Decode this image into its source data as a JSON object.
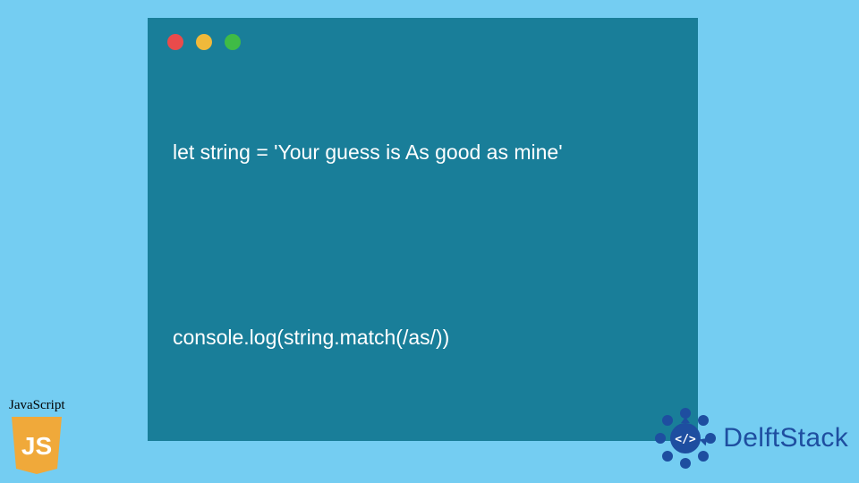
{
  "code_window": {
    "lines": [
      "let string = 'Your guess is As good as mine'",
      "",
      "console.log(string.match(/as/))"
    ]
  },
  "js_badge": {
    "label": "JavaScript",
    "shield_text": "JS",
    "shield_bg": "#f0a93a",
    "shield_fg": "#ffffff"
  },
  "delft": {
    "text": "DelftStack",
    "logo_color": "#1e4ea0",
    "logo_inner": "</>"
  },
  "colors": {
    "page_bg": "#74cdf2",
    "window_bg": "#197e99",
    "dot_red": "#e94b4b",
    "dot_yellow": "#f0b93a",
    "dot_green": "#3fbb46"
  }
}
